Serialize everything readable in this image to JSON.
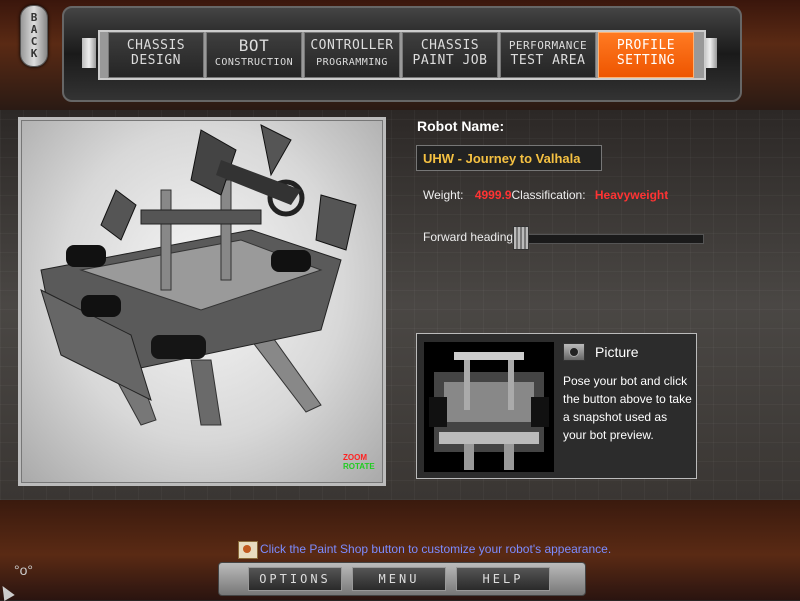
{
  "nav": {
    "back_label": "BACK",
    "tabs": [
      {
        "line1": "CHASSIS",
        "line2": "DESIGN",
        "active": false
      },
      {
        "line1": "BOT",
        "line2": "CONSTRUCTION",
        "active": false
      },
      {
        "line1": "CONTROLLER",
        "line2": "PROGRAMMING",
        "active": false
      },
      {
        "line1": "CHASSIS",
        "line2": "PAINT JOB",
        "active": false
      },
      {
        "line1": "PERFORMANCE",
        "line2": "TEST AREA",
        "active": false
      },
      {
        "line1": "PROFILE",
        "line2": "SETTING",
        "active": true
      }
    ],
    "active_color": "#ff6611"
  },
  "preview": {
    "zoom_label": "ZOOM",
    "rotate_label": "ROTATE"
  },
  "profile": {
    "robot_name_label": "Robot Name:",
    "robot_name_value": "UHW - Journey to Valhala",
    "weight_label": "Weight:",
    "weight_value": "4999.9",
    "classification_label": "Classification:",
    "classification_value": "Heavyweight",
    "heading_label": "Forward heading:",
    "value_color": "#ff3333",
    "name_color": "#f5c142"
  },
  "picture": {
    "title": "Picture",
    "description": "Pose your bot and click the button above to take a snapshot used as your bot preview.",
    "camera_icon": "camera-icon"
  },
  "tip": {
    "icon": "tip-icon",
    "text": "Click the Paint Shop button to customize your robot's appearance."
  },
  "bottom_menu": {
    "options_label": "OPTIONS",
    "menu_label": "MENU",
    "help_label": "HELP"
  }
}
